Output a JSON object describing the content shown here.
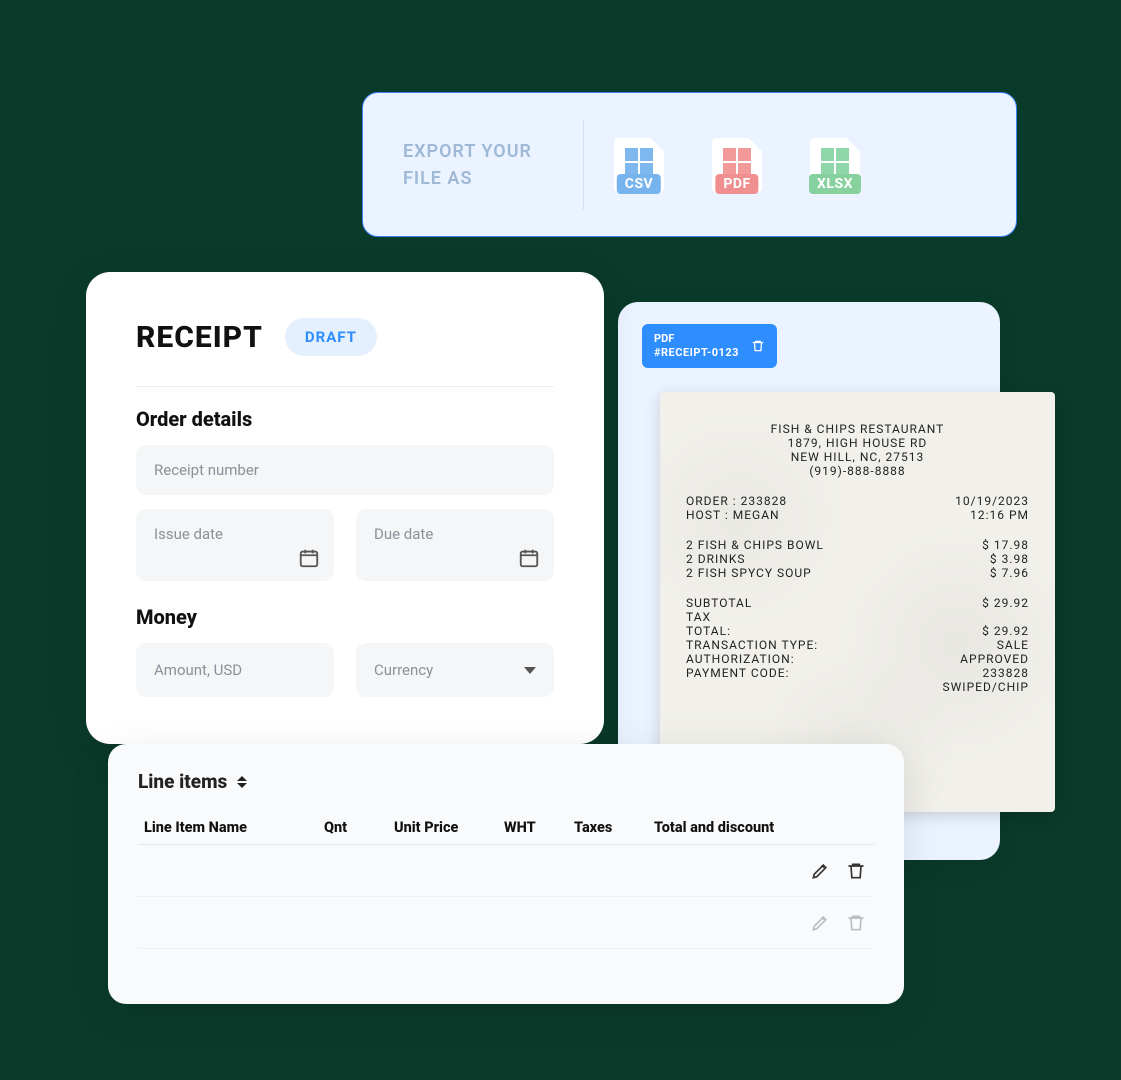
{
  "export": {
    "label": "EXPORT YOUR FILE AS",
    "options": [
      "CSV",
      "PDF",
      "XLSX"
    ]
  },
  "preview_chip": {
    "type": "PDF",
    "id": "#RECEIPT-0123"
  },
  "form": {
    "title": "RECEIPT",
    "status": "DRAFT",
    "sections": {
      "order_details": {
        "title": "Order details",
        "receipt_number_placeholder": "Receipt number",
        "issue_date_placeholder": "Issue date",
        "due_date_placeholder": "Due date"
      },
      "money": {
        "title": "Money",
        "amount_placeholder": "Amount, USD",
        "currency_placeholder": "Currency"
      }
    }
  },
  "line_items": {
    "title": "Line items",
    "columns": [
      "Line Item Name",
      "Qnt",
      "Unit Price",
      "WHT",
      "Taxes",
      "Total and discount"
    ]
  },
  "receipt_preview": {
    "merchant": "FISH & CHIPS RESTAURANT",
    "address1": "1879, HIGH HOUSE RD",
    "address2": "NEW HILL, NC, 27513",
    "phone": "(919)-888-8888",
    "order_label": "ORDER :",
    "order_value": "233828",
    "date": "10/19/2023",
    "host_label": "HOST :",
    "host_value": "MEGAN",
    "time": "12:16 PM",
    "items": [
      {
        "line": "2 FISH & CHIPS BOWL",
        "price": "$ 17.98"
      },
      {
        "line": "2 DRINKS",
        "price": "$ 3.98"
      },
      {
        "line": "2 FISH SPYCY SOUP",
        "price": "$ 7.96"
      }
    ],
    "subtotal_label": "SUBTOTAL",
    "subtotal_value": "$ 29.92",
    "tax_label": "TAX",
    "total_label": "TOTAL:",
    "total_value": "$ 29.92",
    "txn_type_label": "TRANSACTION TYPE:",
    "txn_type_value": "SALE",
    "auth_label": "AUTHORIZATION:",
    "auth_value": "APPROVED",
    "pay_code_label": "PAYMENT CODE:",
    "pay_code_value": "233828",
    "entry_method": "SWIPED/CHIP"
  }
}
